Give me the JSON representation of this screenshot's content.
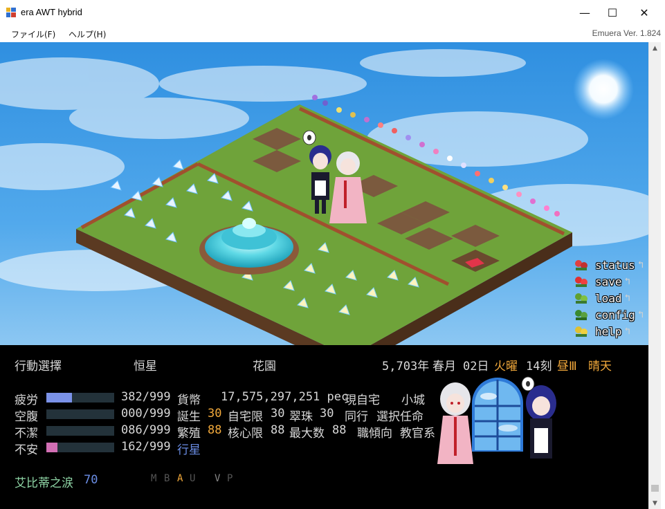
{
  "window": {
    "title": "era AWT hybrid",
    "minimize": "—",
    "maximize": "☐",
    "close": "✕"
  },
  "menubar": {
    "file": "ファイル(F)",
    "help": "ヘルプ(H)",
    "version": "Emuera Ver. 1.824"
  },
  "scene_menu": {
    "status": "status",
    "save": "save",
    "load": "load",
    "config": "config",
    "help": "help",
    "arrow": "↰"
  },
  "info": {
    "action": "行動選擇",
    "location1": "恒星",
    "location2": "花園",
    "year": "5,703年",
    "season": "春月",
    "day": "02日",
    "weekday": "火曜",
    "hour": "14刻",
    "period": "昼Ⅲ",
    "weather": "晴天"
  },
  "stats": [
    {
      "label": "疲労",
      "value": "382/999",
      "ratio": 0.382,
      "color": "#7b92e8"
    },
    {
      "label": "空腹",
      "value": "000/999",
      "ratio": 0.0,
      "color": "#7b92e8"
    },
    {
      "label": "不潔",
      "value": "086/999",
      "ratio": 0.086,
      "color": "#23323a"
    },
    {
      "label": "不安",
      "value": "162/999",
      "ratio": 0.162,
      "color": "#d26fb4"
    }
  ],
  "details": {
    "currency_label": "貨幣",
    "currency_value": "17,575,297,251 pec",
    "home_label": "現自宅",
    "home_value": "小城",
    "birth_label": "誕生",
    "birth_value": "30",
    "home_limit_label": "自宅限",
    "home_limit_value": "30",
    "jade_label": "翠珠",
    "jade_value": "30",
    "companion_label": "同行",
    "companion_value": "選択任命",
    "breed_label": "繁殖",
    "breed_value": "88",
    "core_limit_label": "核心限",
    "core_limit_value": "88",
    "max_label": "最大数",
    "max_value": "88",
    "job_label": "職傾向",
    "job_value": "教官系",
    "star_link": "行星"
  },
  "bottom": {
    "tears_label": "艾比蒂之涙",
    "tears_value": "70",
    "letters": [
      "M",
      "B",
      "A",
      "U",
      "V",
      "P"
    ]
  },
  "colors": {
    "panel_bg": "#000000",
    "accent_orange": "#f2a93b",
    "accent_blue": "#6b8ee6",
    "accent_green": "#8fd6a6",
    "sky": "#2f8fe0"
  }
}
